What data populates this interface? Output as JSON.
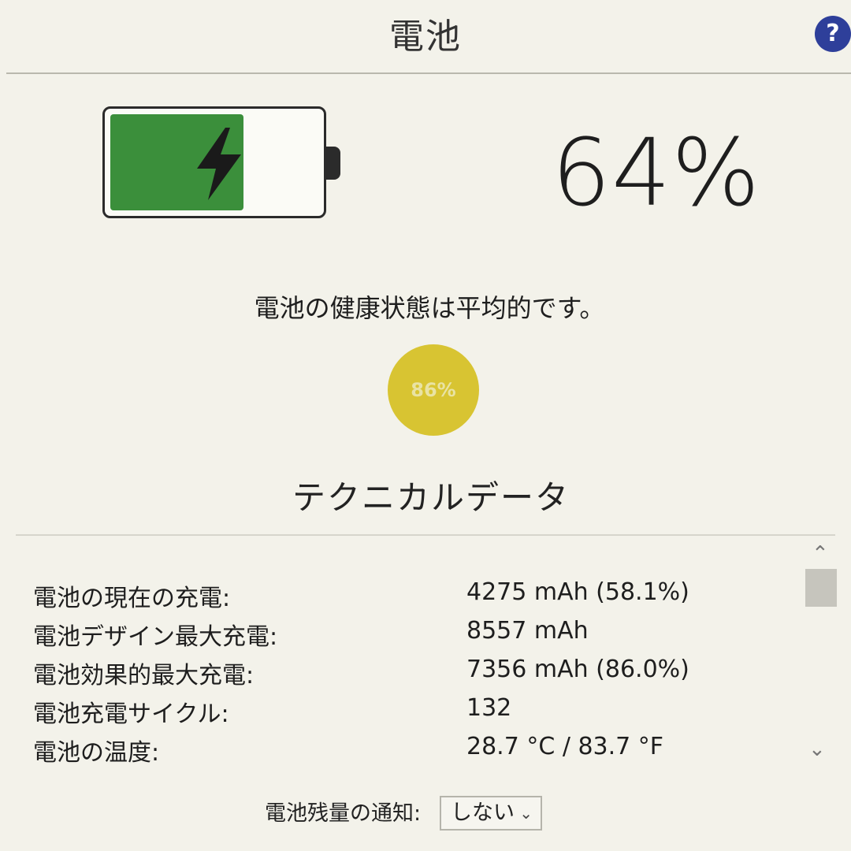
{
  "header": {
    "title": "電池",
    "help_label": "?"
  },
  "battery": {
    "percent_text": "64%",
    "level": 0.64,
    "fill_color": "#3b8f3b",
    "icon": "charging-bolt-icon"
  },
  "health": {
    "message": "電池の健康状態は平均的です。",
    "badge_text": "86%",
    "badge_color": "#d8c432"
  },
  "technical": {
    "heading": "テクニカルデータ",
    "rows": [
      {
        "label": "電池の現在の充電:",
        "value": "4275 mAh (58.1%)"
      },
      {
        "label": "電池デザイン最大充電:",
        "value": "8557 mAh"
      },
      {
        "label": "電池効果的最大充電:",
        "value": "7356 mAh (86.0%)"
      },
      {
        "label": "電池充電サイクル:",
        "value": "132"
      },
      {
        "label": "電池の温度:",
        "value": "28.7 °C / 83.7 °F"
      }
    ]
  },
  "notification": {
    "label": "電池残量の通知:",
    "selected": "しない"
  }
}
